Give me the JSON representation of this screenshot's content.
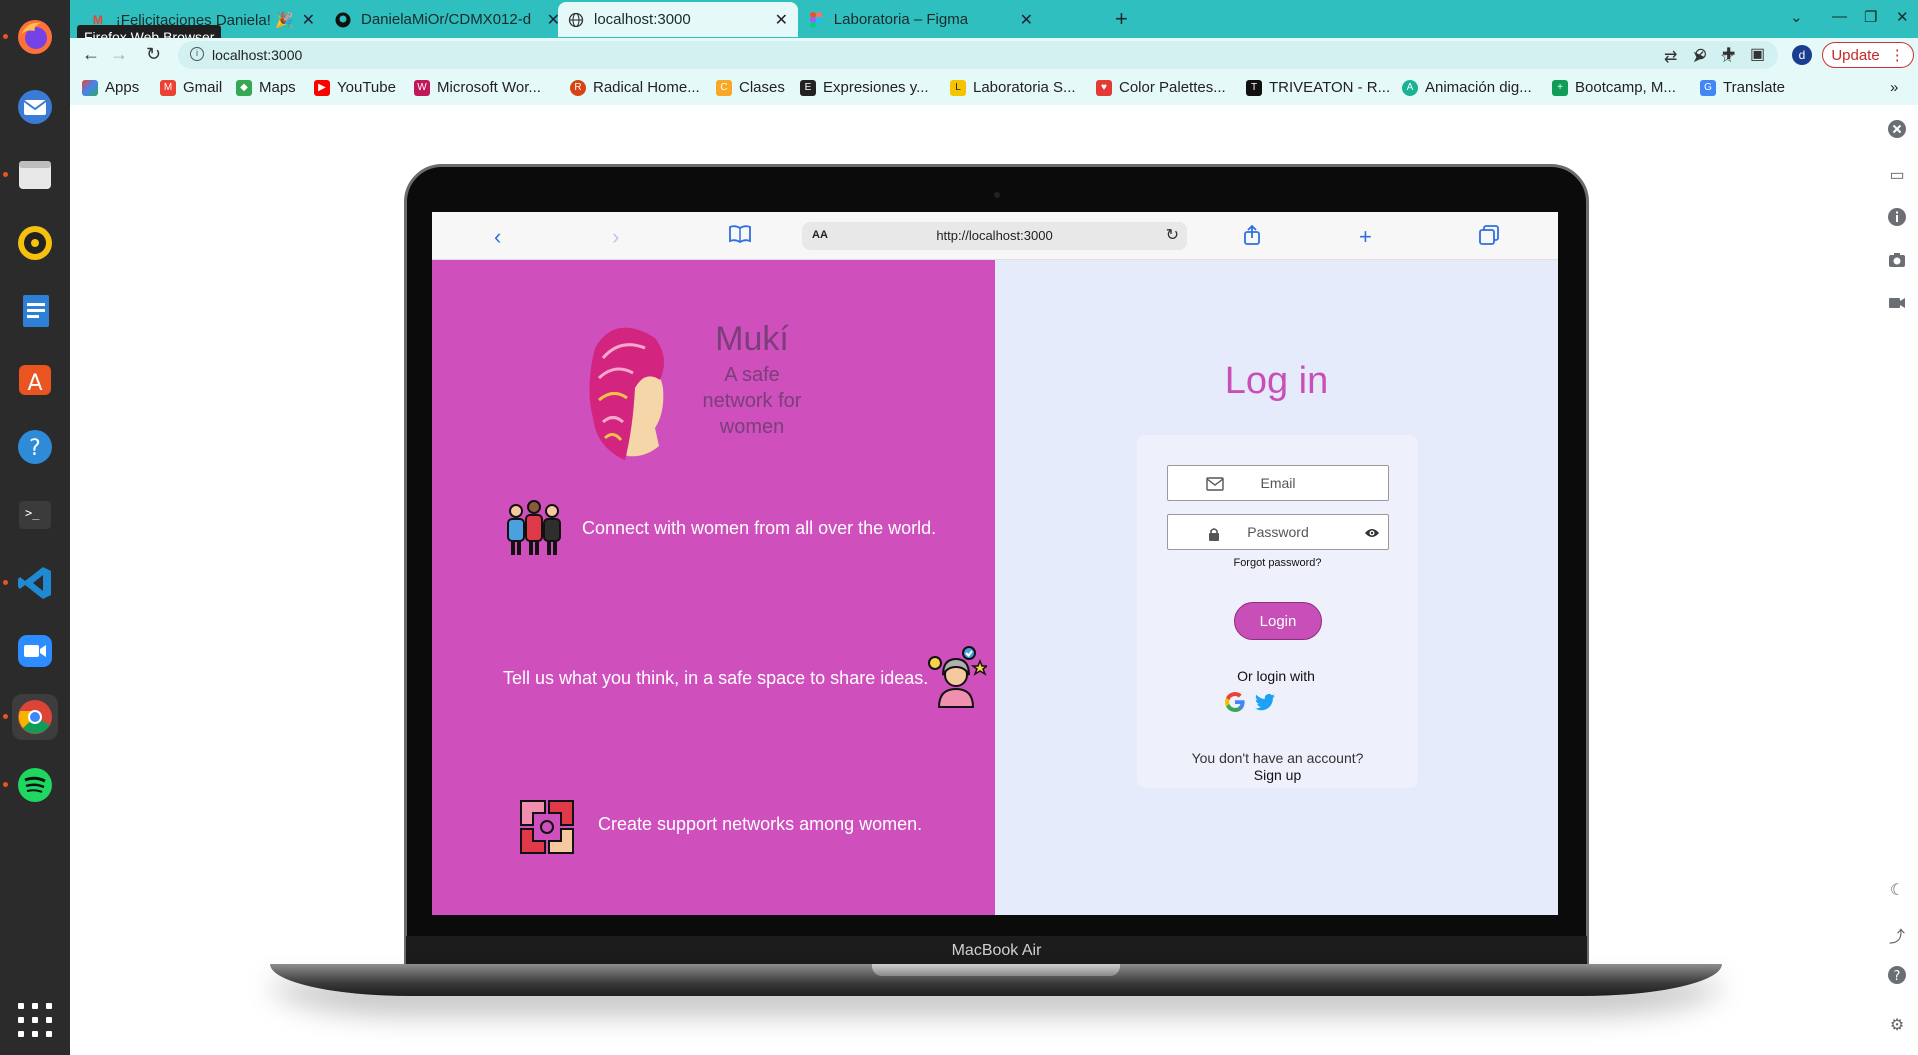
{
  "browser": {
    "tooltip": "Firefox Web Browser",
    "tabs": [
      {
        "title": "¡Felicitaciones Daniela! 🎉"
      },
      {
        "title": "DanielaMiOr/CDMX012-d"
      },
      {
        "title": "localhost:3000"
      },
      {
        "title": "Laboratoria – Figma"
      }
    ],
    "url": "localhost:3000",
    "profile_initial": "d",
    "update_label": "Update",
    "bookmarks": [
      {
        "label": "Apps",
        "color": "#4285f4"
      },
      {
        "label": "Gmail",
        "color": "#ea4335"
      },
      {
        "label": "Maps",
        "color": "#34a853"
      },
      {
        "label": "YouTube",
        "color": "#ff0000"
      },
      {
        "label": "Microsoft Wor...",
        "color": "#c2185b"
      },
      {
        "label": "Radical Home...",
        "color": "#d84315"
      },
      {
        "label": "Clases",
        "color": "#f9a825"
      },
      {
        "label": "Expresiones y...",
        "color": "#222222"
      },
      {
        "label": "Laboratoria S...",
        "color": "#f5c400"
      },
      {
        "label": "Color Palettes...",
        "color": "#e53935"
      },
      {
        "label": "TRIVEATON - R...",
        "color": "#111111"
      },
      {
        "label": "Animación dig...",
        "color": "#19b394"
      },
      {
        "label": "Bootcamp, M...",
        "color": "#0f9d58"
      },
      {
        "label": "Translate",
        "color": "#4285f4"
      }
    ]
  },
  "mockup": {
    "device_label": "MacBook Air",
    "safari_aa": "AA",
    "safari_url": "http://localhost:3000"
  },
  "app": {
    "brand": "Mukí",
    "tagline": "A safe network for women",
    "features": [
      {
        "text": "Connect with women from all over the world."
      },
      {
        "text": "Tell us what you think, in a safe space to share ideas."
      },
      {
        "text": "Create support networks among women."
      }
    ],
    "login": {
      "title": "Log in",
      "email_placeholder": "Email",
      "password_placeholder": "Password",
      "forgot": "Forgot password?",
      "button": "Login",
      "or_login_with": "Or login with",
      "no_account": "You don't have an account?",
      "signup": "Sign up"
    }
  },
  "colors": {
    "pink_panel": "#cf4fbd",
    "accent": "#c84fb8",
    "login_bg": "#e6ebfb",
    "chrome_teal": "#2fbfbf"
  }
}
